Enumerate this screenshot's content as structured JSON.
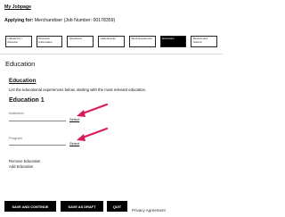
{
  "breadcrumb": {
    "label": "My Jobpage"
  },
  "applying": {
    "label": "Applying for:",
    "job": "Merchandiser (Job Number: 00178359)"
  },
  "steps": [
    {
      "label": "Upload CV / Resume"
    },
    {
      "label": "Personal Information"
    },
    {
      "label": "Questions"
    },
    {
      "label": "Attachments"
    },
    {
      "label": "Work Experience"
    },
    {
      "label": "Education"
    },
    {
      "label": "Review and Submit"
    }
  ],
  "section": {
    "title": "Education"
  },
  "education": {
    "link_label": "Education",
    "description": "List the educational experiences below, starting with the most relevant education.",
    "entry_title": "Education 1",
    "fields": [
      {
        "label": "Institution",
        "value": "",
        "select_label": "Select"
      },
      {
        "label": "Program",
        "value": "",
        "select_label": "Select"
      }
    ],
    "remove_label": "Remove Education",
    "add_label": "Add Education"
  },
  "buttons": {
    "save_continue": "SAVE AND CONTINUE",
    "save_draft": "SAVE AS DRAFT",
    "quit": "QUIT"
  },
  "footer": {
    "privacy_label": "Privacy Agreement"
  },
  "colors": {
    "arrow": "#d81b60",
    "active_step_bg": "#000000",
    "button_bg": "#000000"
  }
}
